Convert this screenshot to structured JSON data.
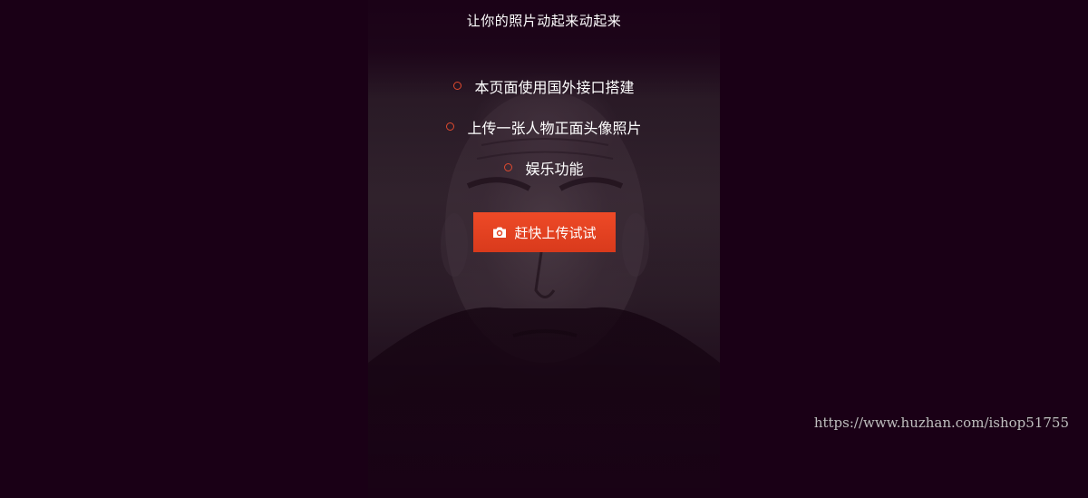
{
  "page": {
    "title": "让你的照片动起来动起来",
    "features": [
      "本页面使用国外接口搭建",
      "上传一张人物正面头像照片",
      "娱乐功能"
    ],
    "upload_button": {
      "label": "赶快上传试试",
      "icon": "camera-icon"
    }
  },
  "watermark": "https://www.huzhan.com/ishop51755",
  "colors": {
    "background": "#1a0016",
    "accent": "#e8431f",
    "bullet": "#e04a2f"
  }
}
